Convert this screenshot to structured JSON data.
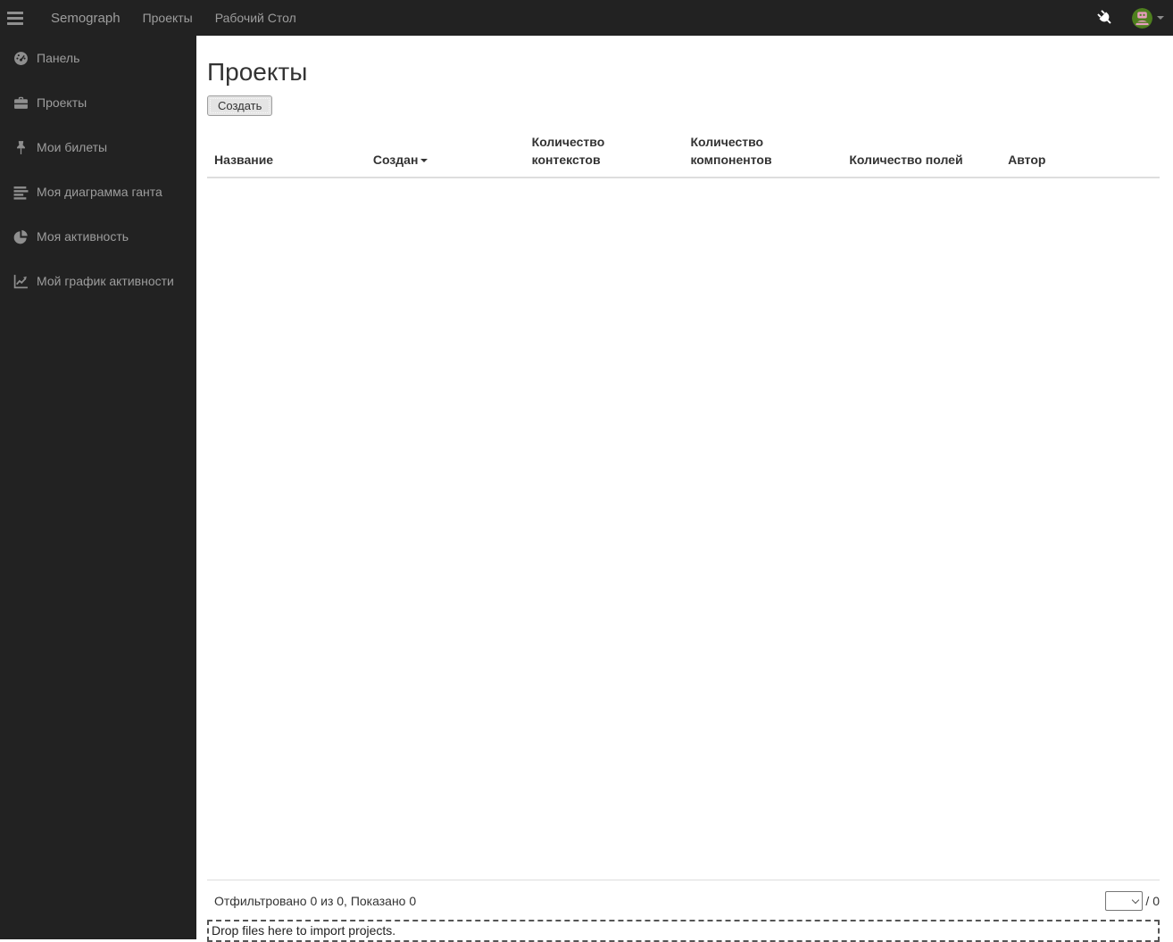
{
  "topbar": {
    "brand": "Semograph",
    "items": [
      {
        "label": "Проекты"
      },
      {
        "label": "Рабочий Стол"
      }
    ],
    "right_icons": [
      "plug-icon",
      "avatar",
      "caret-down-icon"
    ]
  },
  "sidebar": {
    "items": [
      {
        "icon": "gauge-icon",
        "label": "Панель"
      },
      {
        "icon": "briefcase-icon",
        "label": "Проекты"
      },
      {
        "icon": "pin-icon",
        "label": "Мои билеты"
      },
      {
        "icon": "gantt-icon",
        "label": "Моя диаграмма ганта"
      },
      {
        "icon": "pie-chart-icon",
        "label": "Моя активность"
      },
      {
        "icon": "line-chart-icon",
        "label": "Мой график активности"
      }
    ]
  },
  "main": {
    "title": "Проекты",
    "create_button": "Создать",
    "table": {
      "columns": [
        "Название",
        "Создан",
        "Количество контекстов",
        "Количество компонентов",
        "Количество полей",
        "Автор"
      ],
      "sort": {
        "column": "Создан",
        "direction": "desc"
      },
      "rows": []
    },
    "footer": {
      "summary": "Отфильтровано 0 из 0, Показано 0",
      "page_select_value": "",
      "page_total": "/ 0"
    },
    "dropzone_text": "Drop files here to import projects."
  },
  "colors": {
    "topbar_bg": "#222222",
    "sidebar_bg": "#222222",
    "nav_text": "#9d9d9d",
    "content_bg": "#ffffff",
    "heading_text": "#333333",
    "table_border": "#dddddd",
    "dropzone_border": "#555555",
    "avatar_green": "#4e7f1e",
    "avatar_pink": "#e79dbd"
  }
}
